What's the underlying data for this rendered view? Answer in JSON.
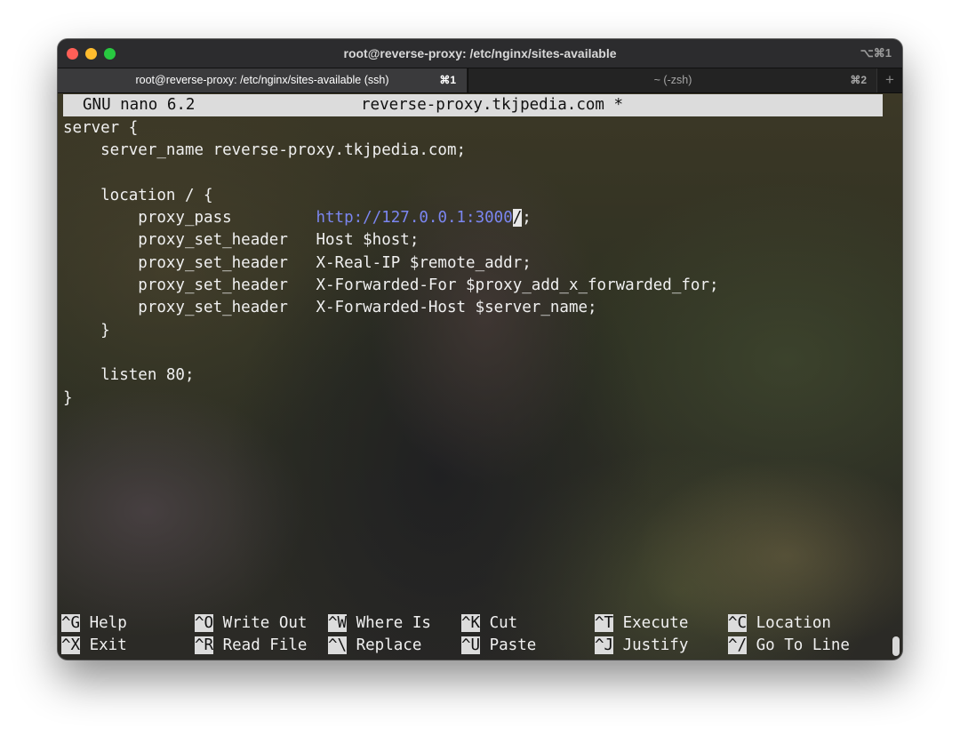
{
  "window": {
    "title": "root@reverse-proxy: /etc/nginx/sites-available",
    "shortcut": "⌥⌘1",
    "controls": [
      "close",
      "minimize",
      "zoom"
    ]
  },
  "tabs": [
    {
      "label": "root@reverse-proxy: /etc/nginx/sites-available (ssh)",
      "shortcut": "⌘1",
      "active": true
    },
    {
      "label": "~ (-zsh)",
      "shortcut": "⌘2",
      "active": false
    }
  ],
  "new_tab_icon": "plus-icon",
  "nano": {
    "version": "GNU nano 6.2",
    "filename": "reverse-proxy.tkjpedia.com *"
  },
  "code": {
    "line1": "server {",
    "line2": "    server_name reverse-proxy.tkjpedia.com;",
    "line3": "",
    "line4": "    location / {",
    "line5_pre": "        proxy_pass         ",
    "line5_url": "http://127.0.0.1:3000",
    "line5_cursor": "/",
    "line5_post": ";",
    "line6": "        proxy_set_header   Host $host;",
    "line7": "        proxy_set_header   X-Real-IP $remote_addr;",
    "line8": "        proxy_set_header   X-Forwarded-For $proxy_add_x_forwarded_for;",
    "line9": "        proxy_set_header   X-Forwarded-Host $server_name;",
    "line10": "    }",
    "line11": "",
    "line12": "    listen 80;",
    "line13": "}"
  },
  "shortcuts": {
    "help": {
      "key": "^G",
      "label": " Help"
    },
    "write_out": {
      "key": "^O",
      "label": " Write Out"
    },
    "where_is": {
      "key": "^W",
      "label": " Where Is"
    },
    "cut": {
      "key": "^K",
      "label": " Cut"
    },
    "execute": {
      "key": "^T",
      "label": " Execute"
    },
    "location": {
      "key": "^C",
      "label": " Location"
    },
    "exit": {
      "key": "^X",
      "label": " Exit"
    },
    "read_file": {
      "key": "^R",
      "label": " Read File"
    },
    "replace": {
      "key": "^\\",
      "label": " Replace"
    },
    "paste": {
      "key": "^U",
      "label": " Paste"
    },
    "justify": {
      "key": "^J",
      "label": " Justify"
    },
    "go_to_line": {
      "key": "^/",
      "label": " Go To Line"
    }
  },
  "colors": {
    "url": "#7b86f0",
    "header_bg": "#dcdcdc",
    "text": "#f0f0f0"
  }
}
